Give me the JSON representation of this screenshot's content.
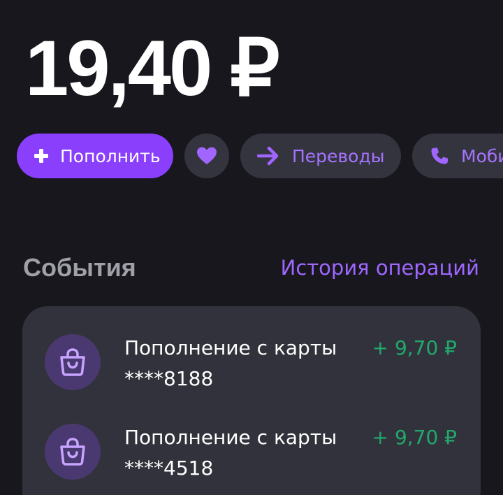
{
  "balance": "19,40 ₽",
  "actions": {
    "top_up_label": "Пополнить",
    "transfers_label": "Переводы",
    "mobile_label": "Мобильная связь"
  },
  "icons": {
    "plus": "plus-icon",
    "heart": "heart-icon",
    "arrow": "arrow-right-icon",
    "phone": "phone-icon",
    "bag": "shopping-bag-icon"
  },
  "events": {
    "title": "События",
    "history_link": "История операций",
    "items": [
      {
        "title": "Пополнение с карты ****8188",
        "amount": "+ 9,70 ₽"
      },
      {
        "title": "Пополнение с карты ****4518",
        "amount": "+ 9,70 ₽"
      }
    ]
  },
  "colors": {
    "background": "#17171d",
    "accent": "#8a3ffc",
    "link": "#a067ff",
    "positive": "#21a86b",
    "card": "#32323c"
  }
}
